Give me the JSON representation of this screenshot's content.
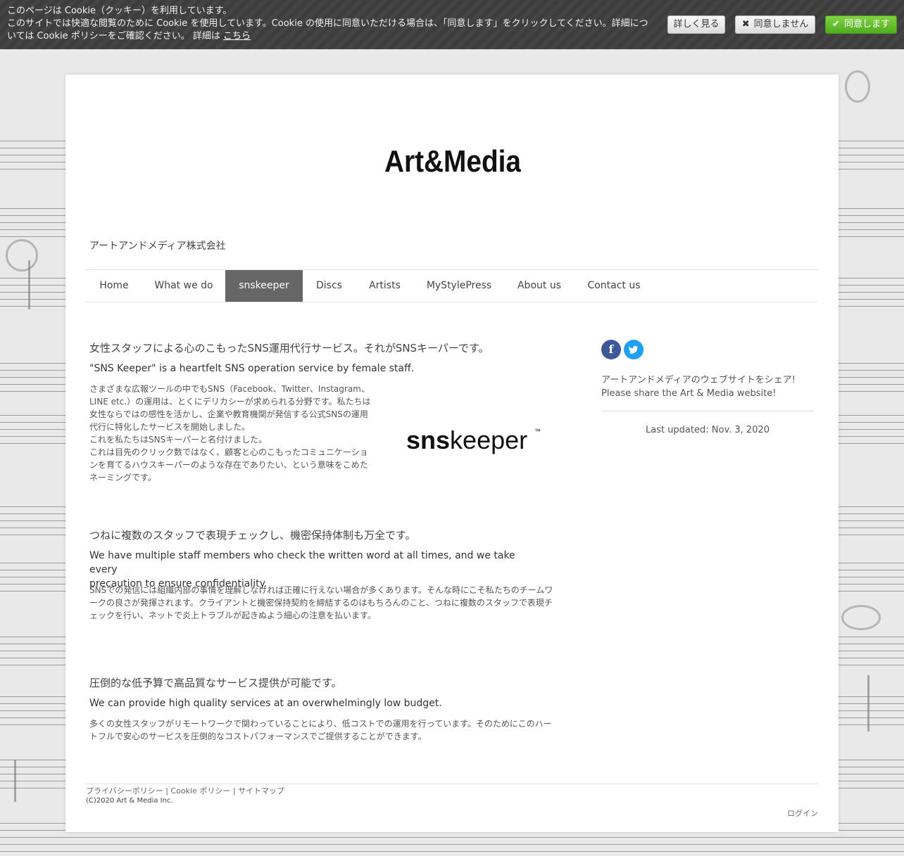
{
  "cookie_banner": {
    "line1": "このページは Cookie（クッキー）を利用しています。",
    "line2": "このサイトでは快適な閲覧のために Cookie を使用しています。Cookie の使用に同意いただける場合は、「同意します」をクリックしてください。詳細につ",
    "line3": "いては Cookie ポリシーをご確認ください。 詳細は",
    "link": "こちら",
    "btn_more": "詳しく見る",
    "btn_deny": "同意しません",
    "btn_agree": "同意します",
    "deny_icon": "✖",
    "agree_icon": "✔"
  },
  "header": {
    "logo_text": "Art&Media",
    "company": "アートアンドメディア株式会社"
  },
  "nav": {
    "items": [
      {
        "label": "Home"
      },
      {
        "label": "What we do"
      },
      {
        "label": "snskeeper"
      },
      {
        "label": "Discs"
      },
      {
        "label": "Artists"
      },
      {
        "label": "MyStylePress"
      },
      {
        "label": "About us"
      },
      {
        "label": "Contact us"
      }
    ],
    "active": "snskeeper"
  },
  "sections": [
    {
      "heading_ja": "女性スタッフによる心のこもったSNS運用代行サービス。それがSNSキーパーです。",
      "heading_en": "\"SNS Keeper\" is a heartfelt SNS operation service by female staff.",
      "body": [
        "さまざまな広報ツールの中でもSNS（Facebook、Twitter、Instagram、",
        "LINE etc.）の運用は、とくにデリカシーが求められる分野です。私たちは",
        "女性ならではの感性を活かし、企業や教育機関が発信する公式SNSの運用",
        "代行に特化したサービスを開始しました。",
        "これを私たちはSNSキーパーと名付けました。",
        "これは目先のクリック数ではなく、顧客と心のこもったコミュニケーショ",
        "ンを育てるハウスキーパーのような存在でありたい、という意味をこめた",
        "ネーミングです。"
      ]
    },
    {
      "heading_ja": "つねに複数のスタッフで表現チェックし、機密保持体制も万全です。",
      "heading_en_1": "We have multiple staff members who check the written word at all times, and we take every",
      "heading_en_2": "precaution to ensure confidentiality.",
      "body": [
        "SNSでの発信には組織内部の事情を理解しなければ正確に行えない場合が多くあります。そんな時にこそ私たちのチームワ",
        "ークの良さが発揮されます。クライアントと機密保持契約を締結するのはもちろんのこと、つねに複数のスタッフで表現チ",
        "ェックを行い、ネットで炎上トラブルが起きぬよう細心の注意を払います。"
      ]
    },
    {
      "heading_ja": "圧倒的な低予算で高品質なサービス提供が可能です。",
      "heading_en": "We can provide high quality services at an overwhelmingly low budget.",
      "body": [
        "多くの女性スタッフがリモートワークで関わっていることにより、低コストでの運用を行っています。そのためにこのハー",
        "トフルで安心のサービスを圧倒的なコストパフォーマンスでご提供することができます。"
      ]
    }
  ],
  "snskeeper_logo": {
    "bold": "sns",
    "rest": "keeper",
    "tm": "™"
  },
  "sidebar": {
    "share_icons": [
      "facebook-icon",
      "twitter-icon"
    ],
    "share_line1": "アートアンドメディアのウェブサイトをシェア!",
    "share_line2": "Please share the Art & Media website!",
    "updated": "Last updated: Nov. 3, 2020"
  },
  "footer": {
    "privacy": "プライバシーポリシー",
    "sep": "|",
    "cookie": "Cookie ポリシー",
    "sitemap": "サイトマップ",
    "copyright": "(C)2020 Art & Media Inc.",
    "login": "ログイン"
  }
}
